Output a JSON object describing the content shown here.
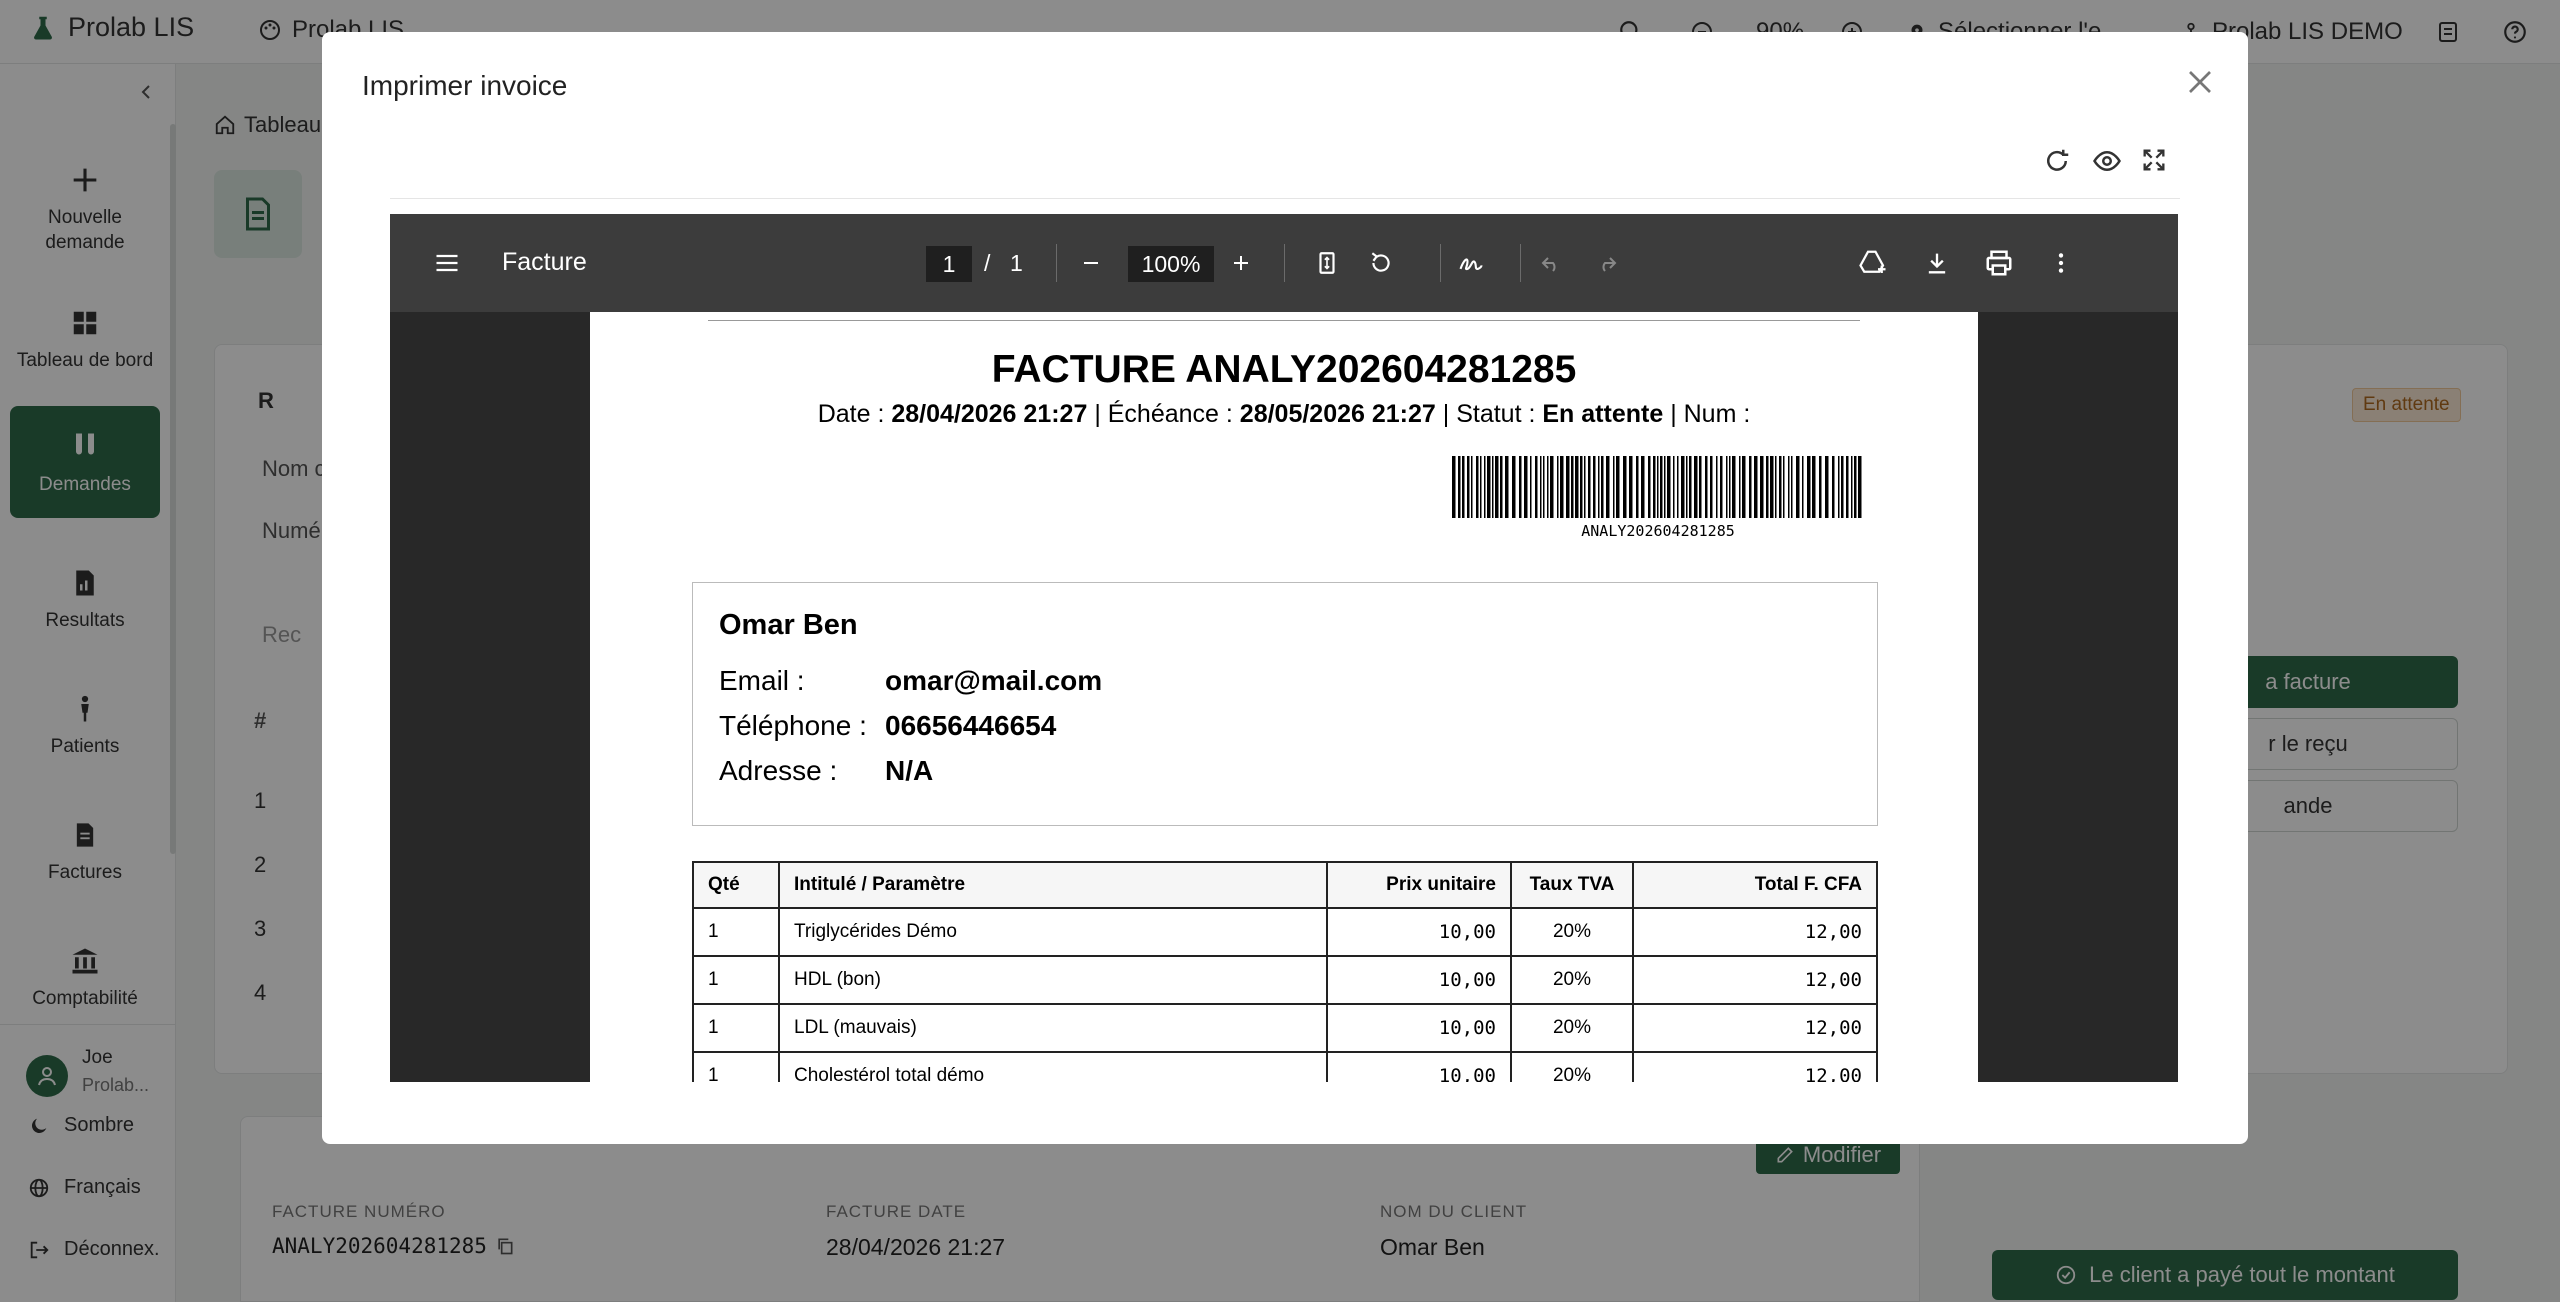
{
  "app": {
    "brand": "Prolab LIS",
    "org_switch": "Prolab LIS",
    "zoom": "90%",
    "select_placeholder": "Sélectionner l'e",
    "tenant": "Prolab LIS DEMO"
  },
  "sidebar": {
    "items": [
      {
        "label": "Nouvelle demande",
        "icon": "plus-icon"
      },
      {
        "label": "Tableau de bord",
        "icon": "dashboard-icon"
      },
      {
        "label": "Demandes",
        "icon": "test-tubes-icon"
      },
      {
        "label": "Resultats",
        "icon": "document-chart-icon"
      },
      {
        "label": "Patients",
        "icon": "person-icon"
      },
      {
        "label": "Factures",
        "icon": "invoice-icon"
      },
      {
        "label": "Comptabilité",
        "icon": "bank-icon"
      }
    ],
    "user": {
      "name": "Joe",
      "org": "Prolab..."
    },
    "theme": "Sombre",
    "language": "Français",
    "logout": "Déconnex."
  },
  "page": {
    "breadcrumb": "Tableau",
    "status": "En attente",
    "card_header": "R",
    "field1": "Nom c",
    "field2": "Numé",
    "search_placeholder": "Rec",
    "table_hash": "#",
    "rows": [
      "1",
      "2",
      "3",
      "4"
    ],
    "actions": [
      "a facture",
      "r le reçu",
      "ande"
    ],
    "modify": "Modifier",
    "info": {
      "invoice_number_label": "FACTURE NUMÉRO",
      "invoice_number": "ANALY202604281285",
      "invoice_date_label": "FACTURE DATE",
      "invoice_date": "28/04/2026 21:27",
      "client_label": "NOM DU CLIENT",
      "client_name": "Omar Ben"
    },
    "paid_button": "Le client a payé tout le montant"
  },
  "modal": {
    "title": "Imprimer invoice",
    "pdf": {
      "doc_title": "Facture",
      "current_page": "1",
      "separator": "/",
      "total_pages": "1",
      "zoom": "100%"
    },
    "invoice": {
      "title": "FACTURE ANALY202604281285",
      "date_label": "Date :",
      "date": "28/04/2026 21:27",
      "due_label": "| Échéance :",
      "due": "28/05/2026 21:27",
      "status_label": "| Statut :",
      "status": "En attente",
      "num_label": "| Num :",
      "barcode_text": "ANALY202604281285",
      "client": {
        "name": "Omar Ben",
        "email_label": "Email :",
        "email": "omar@mail.com",
        "phone_label": "Téléphone :",
        "phone": "06656446654",
        "address_label": "Adresse :",
        "address": "N/A"
      },
      "table": {
        "headers": [
          "Qté",
          "Intitulé / Paramètre",
          "Prix unitaire",
          "Taux TVA",
          "Total F. CFA"
        ],
        "rows": [
          [
            "1",
            "Triglycérides Démo",
            "10,00",
            "20%",
            "12,00"
          ],
          [
            "1",
            "HDL (bon)",
            "10,00",
            "20%",
            "12,00"
          ],
          [
            "1",
            "LDL (mauvais)",
            "10,00",
            "20%",
            "12,00"
          ],
          [
            "1",
            "Cholestérol total démo",
            "10,00",
            "20%",
            "12,00"
          ]
        ]
      }
    }
  }
}
